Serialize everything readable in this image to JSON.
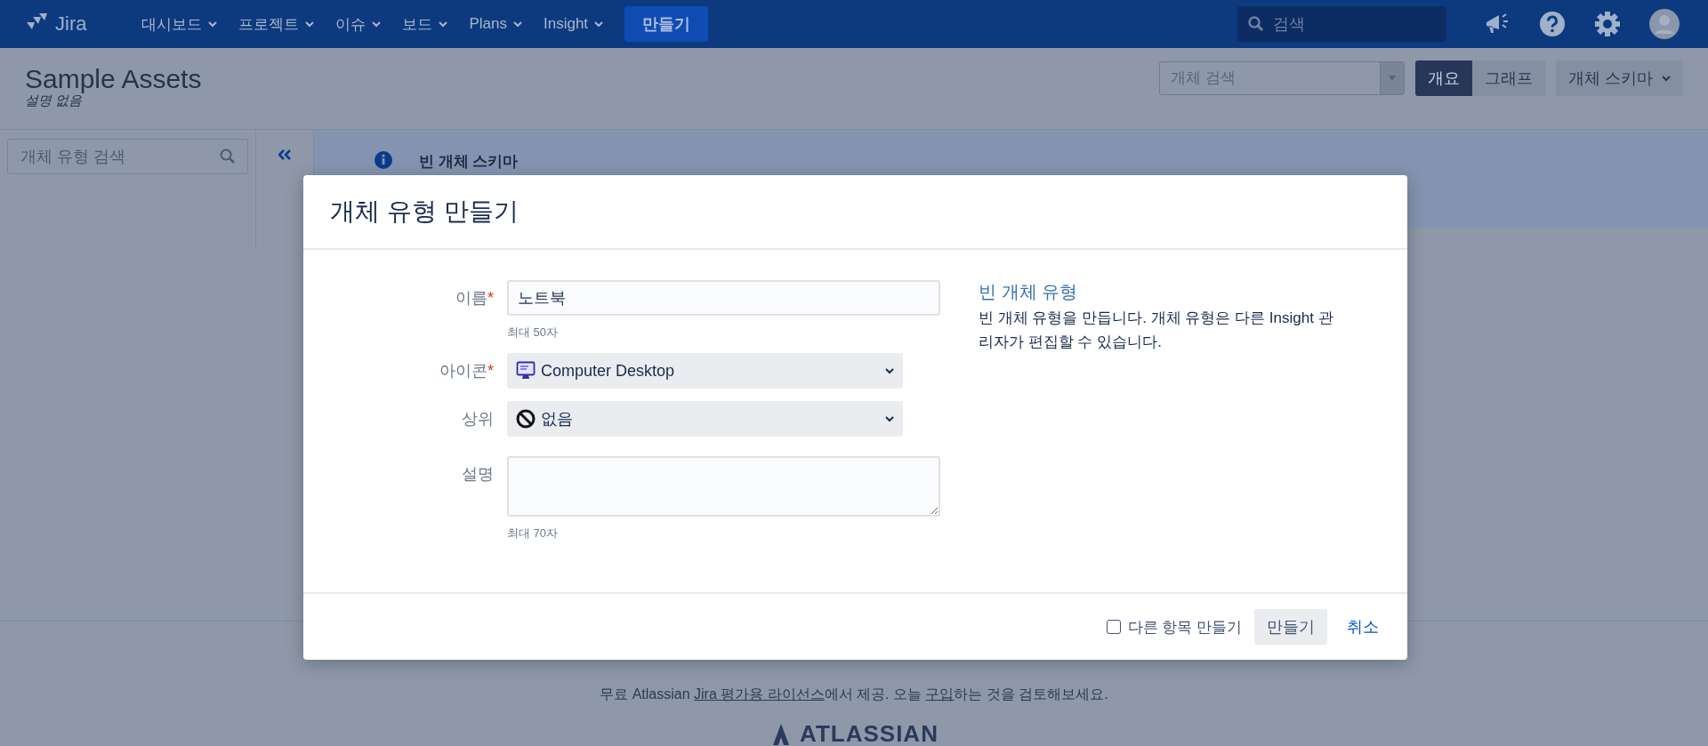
{
  "nav": {
    "logo": "Jira",
    "menus": [
      {
        "label": "대시보드"
      },
      {
        "label": "프로젝트"
      },
      {
        "label": "이슈"
      },
      {
        "label": "보드"
      },
      {
        "label": "Plans"
      },
      {
        "label": "Insight"
      }
    ],
    "create": "만들기",
    "search": {
      "placeholder": "검색"
    }
  },
  "header": {
    "title": "Sample Assets",
    "subtitle": "설명 없음",
    "object_search": {
      "placeholder": "개체 검색"
    },
    "view_tabs": [
      {
        "label": "개요",
        "selected": true
      },
      {
        "label": "그래프",
        "selected": false
      }
    ],
    "schema_menu": "개체 스키마"
  },
  "sidebar": {
    "search": {
      "placeholder": "개체 유형 검색"
    }
  },
  "info_panel": {
    "title": "빈 개체 스키마"
  },
  "dialog": {
    "title": "개체 유형 만들기",
    "name_field": {
      "label": "이름",
      "required": true,
      "value": "노트북",
      "hint": "최대 50자"
    },
    "icon_field": {
      "label": "아이콘",
      "required": true,
      "value": "Computer Desktop"
    },
    "parent_field": {
      "label": "상위",
      "required": false,
      "value": "없음"
    },
    "description_field": {
      "label": "설명",
      "required": false,
      "hint": "최대 70자"
    },
    "info": {
      "title": "빈 개체 유형",
      "text": "빈 개체 유형을 만듭니다. 개체 유형은 다른 Insight 관리자가 편집할 수 있습니다."
    },
    "create_another": {
      "label": "다른 항목 만들기",
      "checked": false
    },
    "required_mark": "*",
    "submit": "만들기",
    "cancel": "취소"
  },
  "page_footer": {
    "license_parts": [
      {
        "kind": "text",
        "text": "무료 Atlassian "
      },
      {
        "kind": "link",
        "text": "Jira 평가용 라이선스"
      },
      {
        "kind": "text",
        "text": "에서 제공. 오늘 "
      },
      {
        "kind": "link",
        "text": "구입"
      },
      {
        "kind": "text",
        "text": "하는 것을 검토해보세요."
      }
    ],
    "logo": "ATLASSIAN"
  }
}
